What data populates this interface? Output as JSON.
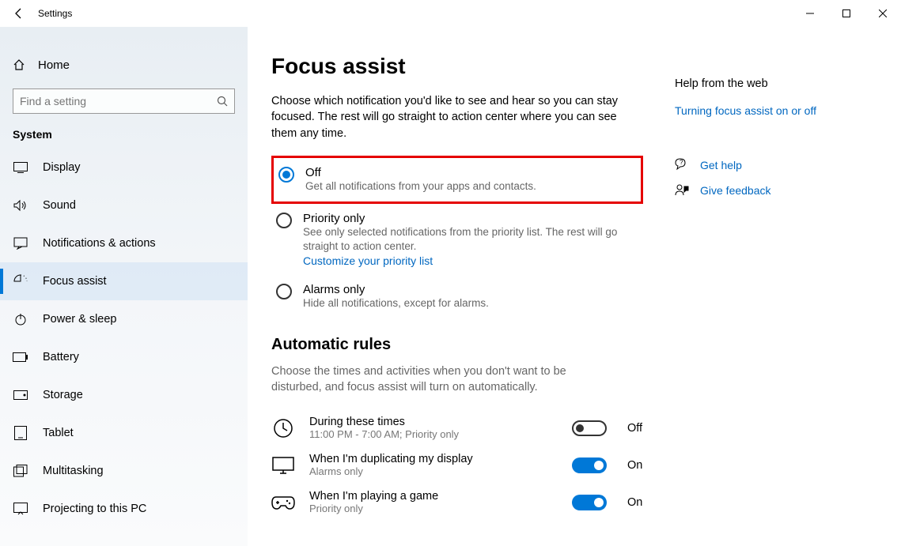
{
  "window": {
    "app_title": "Settings"
  },
  "sidebar": {
    "home": "Home",
    "search_placeholder": "Find a setting",
    "category": "System",
    "items": [
      {
        "label": "Display"
      },
      {
        "label": "Sound"
      },
      {
        "label": "Notifications & actions"
      },
      {
        "label": "Focus assist"
      },
      {
        "label": "Power & sleep"
      },
      {
        "label": "Battery"
      },
      {
        "label": "Storage"
      },
      {
        "label": "Tablet"
      },
      {
        "label": "Multitasking"
      },
      {
        "label": "Projecting to this PC"
      }
    ]
  },
  "page": {
    "title": "Focus assist",
    "description": "Choose which notification you'd like to see and hear so you can stay focused. The rest will go straight to action center where you can see them any time.",
    "options": [
      {
        "title": "Off",
        "sub": "Get all notifications from your apps and contacts."
      },
      {
        "title": "Priority only",
        "sub": "See only selected notifications from the priority list. The rest will go straight to action center.",
        "link": "Customize your priority list"
      },
      {
        "title": "Alarms only",
        "sub": "Hide all notifications, except for alarms."
      }
    ],
    "rules_title": "Automatic rules",
    "rules_desc": "Choose the times and activities when you don't want to be disturbed, and focus assist will turn on automatically.",
    "rules": [
      {
        "title": "During these times",
        "sub": "11:00 PM - 7:00 AM; Priority only",
        "state": "Off"
      },
      {
        "title": "When I'm duplicating my display",
        "sub": "Alarms only",
        "state": "On"
      },
      {
        "title": "When I'm playing a game",
        "sub": "Priority only",
        "state": "On"
      }
    ]
  },
  "help": {
    "heading": "Help from the web",
    "link1": "Turning focus assist on or off",
    "get_help": "Get help",
    "feedback": "Give feedback"
  }
}
